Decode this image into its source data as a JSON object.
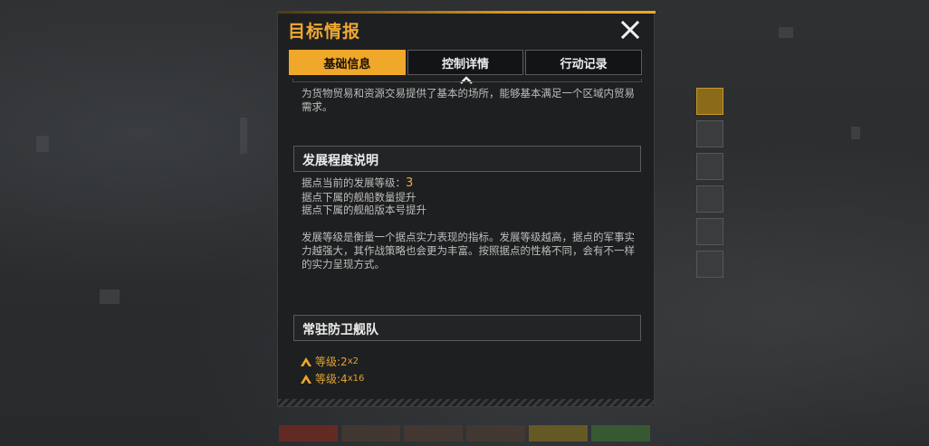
{
  "dialog": {
    "title": "目标情报",
    "tabs": [
      {
        "label": "基础信息",
        "active": true
      },
      {
        "label": "控制详情",
        "active": false
      },
      {
        "label": "行动记录",
        "active": false
      }
    ],
    "description": "为货物贸易和资源交易提供了基本的场所，能够基本满足一个区域内贸易需求。",
    "development": {
      "heading": "发展程度说明",
      "level_prefix": "据点当前的发展等级：",
      "level_value": "3",
      "line2": "据点下属的舰船数量提升",
      "line3": "据点下属的舰船版本号提升",
      "note": "发展等级是衡量一个据点实力表现的指标。发展等级越高，据点的军事实力越强大，其作战策略也会更为丰富。按照据点的性格不同，会有不一样的实力呈现方式。"
    },
    "fleet": {
      "heading": "常驻防卫舰队",
      "entries": [
        {
          "label": "等级:2",
          "count": "x2"
        },
        {
          "label": "等级:4",
          "count": "x16"
        }
      ]
    }
  },
  "colors": {
    "accent": "#f0a82a",
    "panel_bg": "#1e1f20",
    "text": "#bdbdbd"
  },
  "icons": {
    "close": "close-icon",
    "rank": "chevron-up-icon",
    "scroll": "chevron-up-icon"
  }
}
